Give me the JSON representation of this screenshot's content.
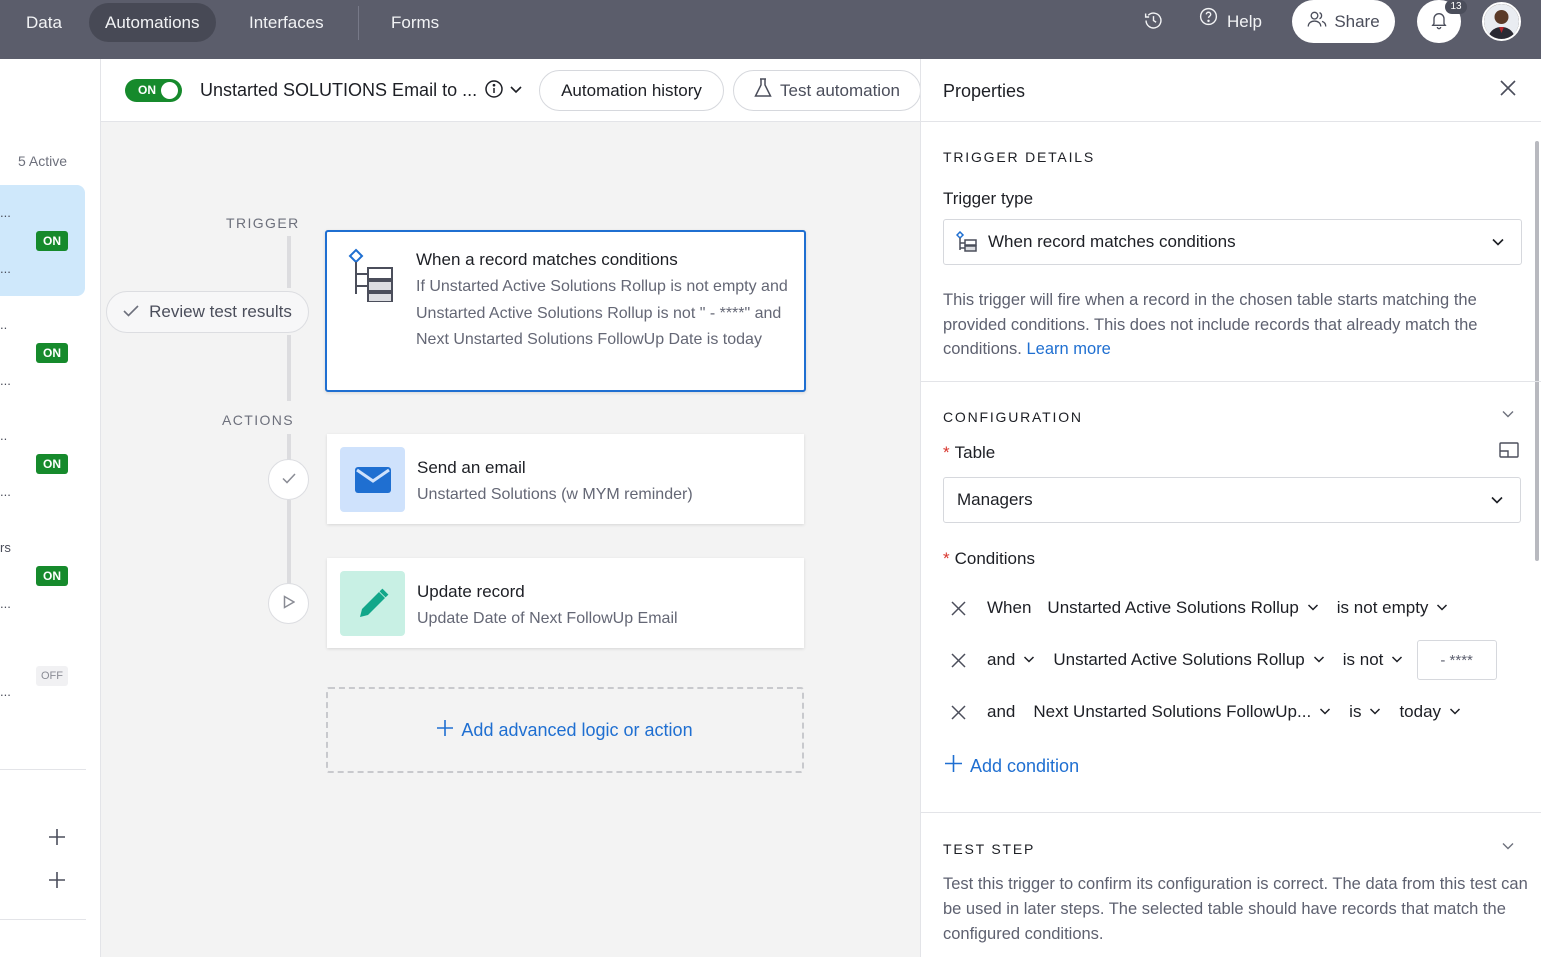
{
  "topbar": {
    "tabs": [
      "Data",
      "Automations",
      "Interfaces",
      "Forms"
    ],
    "help_label": "Help",
    "share_label": "Share",
    "notification_count": "13"
  },
  "rail": {
    "active_count": "5 Active",
    "items": [
      {
        "dots": "...",
        "sub": "...",
        "status": "ON"
      },
      {
        "dots": "..",
        "sub": "...",
        "status": "ON"
      },
      {
        "dots": "..",
        "sub": "...",
        "status": "ON"
      },
      {
        "dots": "rs",
        "sub": "...",
        "status": "ON"
      },
      {
        "dots": "",
        "sub": "...",
        "status": "OFF"
      }
    ]
  },
  "header": {
    "toggle_label": "ON",
    "title": "Unstarted SOLUTIONS Email to ...",
    "history_label": "Automation history",
    "test_label": "Test automation"
  },
  "canvas": {
    "trigger_label": "TRIGGER",
    "actions_label": "ACTIONS",
    "review_label": "Review test results",
    "trigger_card": {
      "title": "When a record matches conditions",
      "subtitle": "If Unstarted Active Solutions Rollup is not empty and Unstarted Active Solutions Rollup is not \" - ****\" and Next Unstarted Solutions FollowUp Date is today"
    },
    "actions": [
      {
        "title": "Send an email",
        "subtitle": "Unstarted Solutions (w MYM reminder)"
      },
      {
        "title": "Update record",
        "subtitle": "Update Date of Next FollowUp Email"
      }
    ],
    "add_label": "Add advanced logic or action"
  },
  "properties": {
    "title": "Properties",
    "trigger_details_heading": "TRIGGER DETAILS",
    "trigger_type_label": "Trigger type",
    "trigger_type_value": "When record matches conditions",
    "description": "This trigger will fire when a record in the chosen table starts matching the provided conditions. This does not include records that already match the conditions.",
    "learn_more": "Learn more",
    "configuration_heading": "CONFIGURATION",
    "table_label": "Table",
    "table_value": "Managers",
    "conditions_label": "Conditions",
    "conditions": [
      {
        "joiner": "When",
        "field": "Unstarted Active Solutions Rollup",
        "operator": "is not empty",
        "value": ""
      },
      {
        "joiner": "and",
        "field": "Unstarted Active Solutions Rollup",
        "operator": "is not",
        "value": "- ****"
      },
      {
        "joiner": "and",
        "field": "Next Unstarted Solutions FollowUp...",
        "operator": "is",
        "value": "today"
      }
    ],
    "add_condition_label": "Add condition",
    "test_step_heading": "TEST STEP",
    "test_step_description": "Test this trigger to confirm its configuration is correct. The data from this test can be used in later steps. The selected table should have records that match the configured conditions."
  },
  "colors": {
    "topbar": "#5b5d6b",
    "accent": "#1f6fd1",
    "on_green": "#168a2c",
    "selected_bg": "#cfe8fb"
  }
}
